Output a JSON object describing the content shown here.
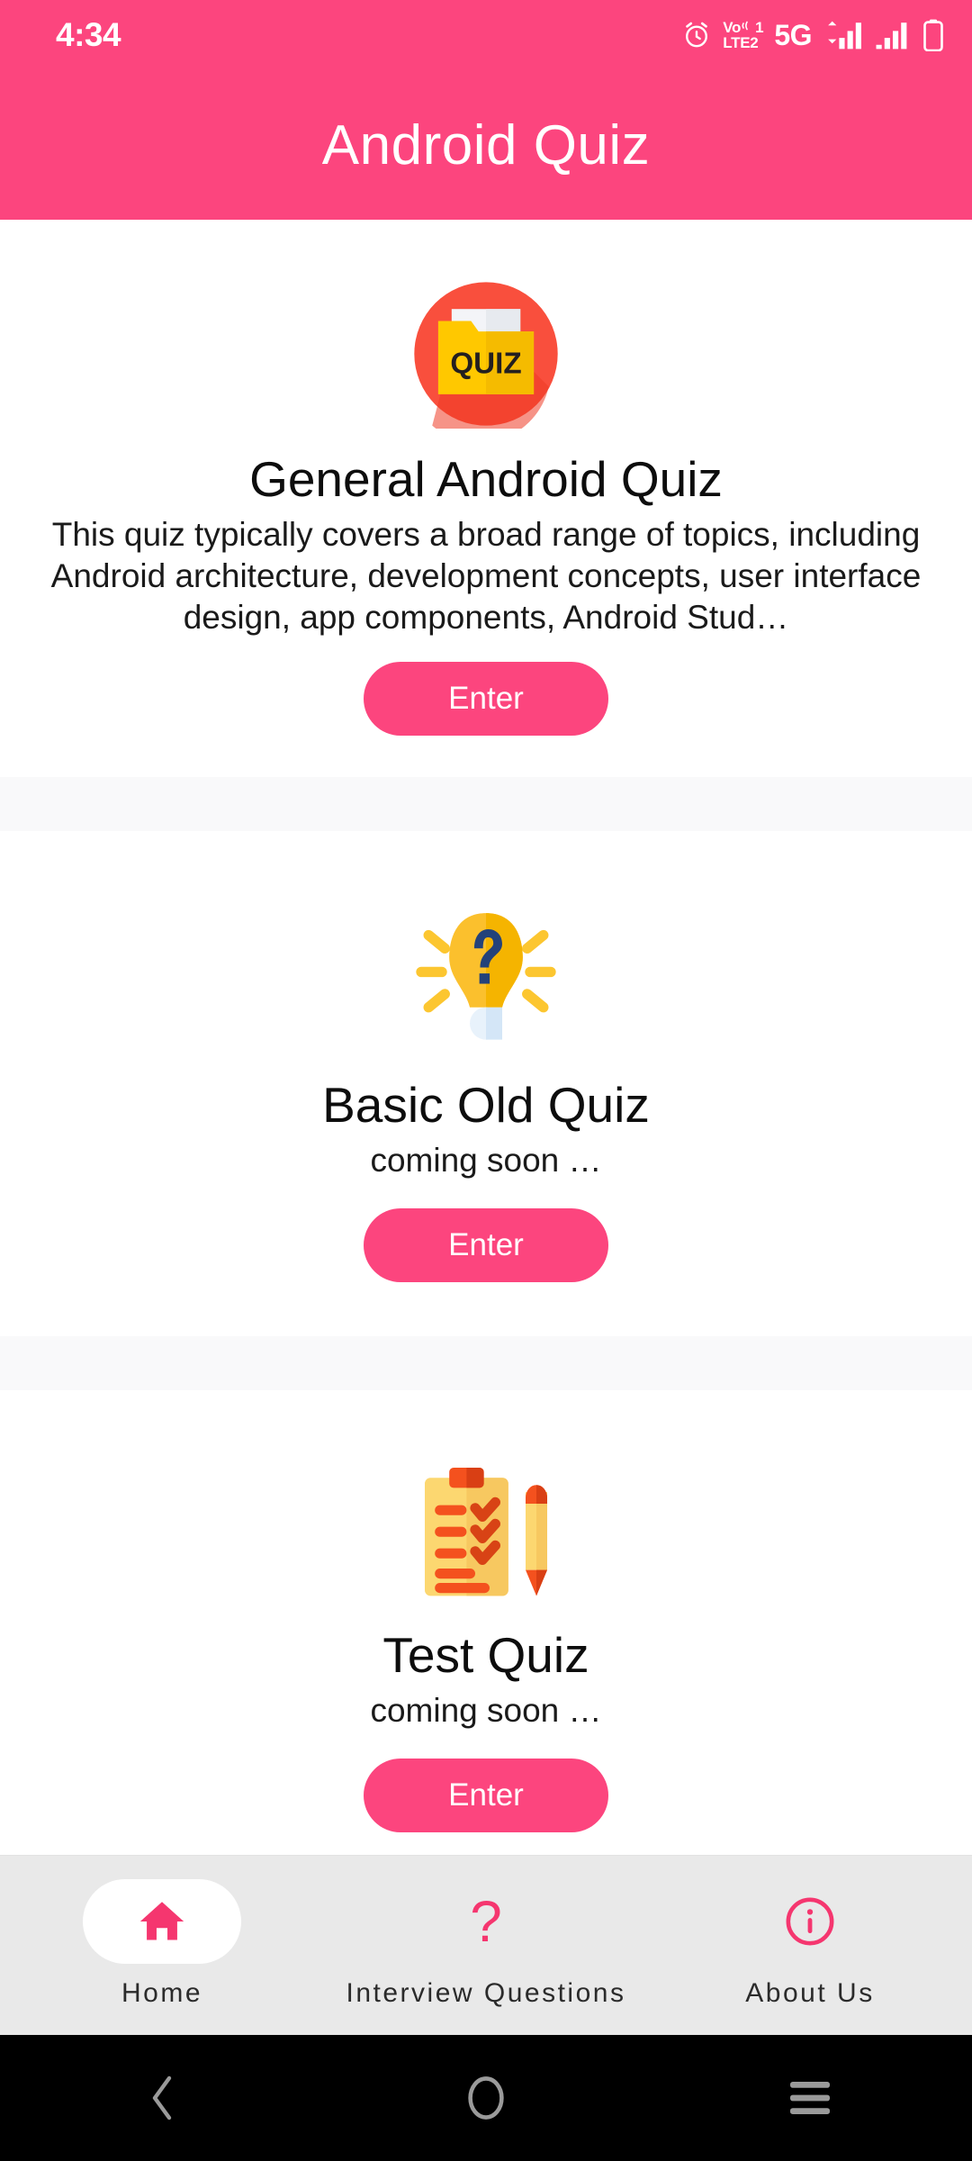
{
  "status_bar": {
    "time": "4:34",
    "icons": [
      {
        "name": "alarm-icon",
        "label": "alarm"
      },
      {
        "name": "volte-icon",
        "label": "VoLTE 1 / LTE 2",
        "sim_one": "1",
        "sim_two": "2",
        "line_one": "Vo",
        "line_two": "LTE"
      },
      {
        "name": "network-type-label",
        "label": "5G"
      },
      {
        "name": "signal-bars-sim1-icon",
        "label": "signal bars sim 1"
      },
      {
        "name": "signal-bars-sim2-icon",
        "label": "signal bars sim 2"
      },
      {
        "name": "battery-icon",
        "label": "battery"
      }
    ]
  },
  "app_bar": {
    "title": "Android Quiz",
    "background_color": "#fc457e",
    "title_color": "#ffffff"
  },
  "theme": {
    "accent": "#fc457e",
    "nav_accent": "#f5366f",
    "page_background": "#ffffff",
    "divider": "#f9f9fa",
    "bottom_nav_background": "#e9e9e9",
    "system_nav_background": "#000000"
  },
  "cards": [
    {
      "icon_name": "quiz-folder-icon",
      "title": "General Android Quiz",
      "description": "This quiz typically covers a broad range of topics, including Android architecture, development concepts, user interface design, app components, Android Stud…",
      "button_label": "Enter"
    },
    {
      "icon_name": "lightbulb-question-icon",
      "title": "Basic Old Quiz",
      "description": "coming soon …",
      "button_label": "Enter"
    },
    {
      "icon_name": "clipboard-checklist-pencil-icon",
      "title": "Test Quiz",
      "description": "coming soon …",
      "button_label": "Enter"
    }
  ],
  "bottom_nav": {
    "items": [
      {
        "label": "Home",
        "icon_name": "home-icon",
        "active": true
      },
      {
        "label": "Interview Questions",
        "icon_name": "question-mark-icon",
        "active": false
      },
      {
        "label": "About Us",
        "icon_name": "info-circle-icon",
        "active": false
      }
    ]
  },
  "system_nav": {
    "back_label": "Back",
    "home_label": "Home",
    "recents_label": "Recents"
  }
}
